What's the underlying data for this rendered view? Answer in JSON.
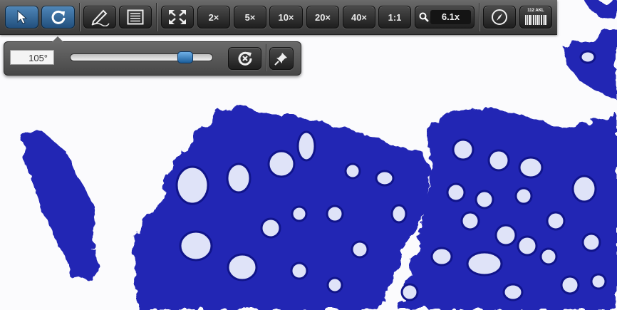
{
  "toolbar": {
    "zoom_buttons": [
      "2×",
      "5×",
      "10×",
      "20×",
      "40×",
      "1:1"
    ],
    "current_zoom": "6.1x",
    "barcode_label": "112 AKL"
  },
  "rotation": {
    "angle": "105°",
    "slider_fraction": 0.81
  },
  "colors": {
    "active_button": "#2f6ea8",
    "tissue_stain": "#1f24b8",
    "background": "#fbfbfd"
  }
}
